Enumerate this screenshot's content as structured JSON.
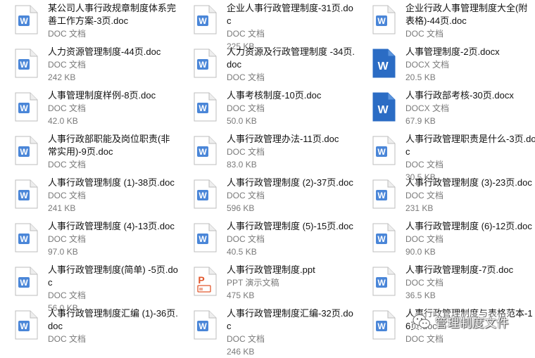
{
  "files": [
    {
      "name": "某公司人事行政规章制度体系完善工作方案-3页.doc",
      "type": "DOC 文档",
      "size": "",
      "icon": "word-doc-icon"
    },
    {
      "name": "企业人事行政管理制度-31页.doc",
      "type": "DOC 文档",
      "size": "225 KB",
      "icon": "word-doc-icon"
    },
    {
      "name": "企业行政人事管理制度大全(附表格)-44页.doc",
      "type": "DOC 文档",
      "size": "",
      "icon": "word-doc-icon"
    },
    {
      "name": "人力资源管理制度-44页.doc",
      "type": "DOC 文档",
      "size": "242 KB",
      "icon": "word-doc-icon"
    },
    {
      "name": "人力资源及行政管理制度 -34页.doc",
      "type": "DOC 文档",
      "size": "",
      "icon": "word-doc-icon"
    },
    {
      "name": "人事管理制度-2页.docx",
      "type": "DOCX 文档",
      "size": "20.5 KB",
      "icon": "word-docx-icon"
    },
    {
      "name": "人事管理制度样例-8页.doc",
      "type": "DOC 文档",
      "size": "42.0 KB",
      "icon": "word-doc-icon"
    },
    {
      "name": "人事考核制度-10页.doc",
      "type": "DOC 文档",
      "size": "50.0 KB",
      "icon": "word-doc-icon"
    },
    {
      "name": "人事行政部考核-30页.docx",
      "type": "DOCX 文档",
      "size": "67.9 KB",
      "icon": "word-docx-icon"
    },
    {
      "name": "人事行政部职能及岗位职责(非常实用)-9页.doc",
      "type": "DOC 文档",
      "size": "",
      "icon": "word-doc-icon"
    },
    {
      "name": "人事行政管理办法-11页.doc",
      "type": "DOC 文档",
      "size": "83.0 KB",
      "icon": "word-doc-icon"
    },
    {
      "name": "人事行政管理职责是什么-3页.doc",
      "type": "DOC 文档",
      "size": "30.5 KB",
      "icon": "word-doc-icon"
    },
    {
      "name": "人事行政管理制度 (1)-38页.doc",
      "type": "DOC 文档",
      "size": "241 KB",
      "icon": "word-doc-icon"
    },
    {
      "name": "人事行政管理制度 (2)-37页.doc",
      "type": "DOC 文档",
      "size": "596 KB",
      "icon": "word-doc-icon"
    },
    {
      "name": "人事行政管理制度 (3)-23页.doc",
      "type": "DOC 文档",
      "size": "231 KB",
      "icon": "word-doc-icon"
    },
    {
      "name": "人事行政管理制度 (4)-13页.doc",
      "type": "DOC 文档",
      "size": "97.0 KB",
      "icon": "word-doc-icon"
    },
    {
      "name": "人事行政管理制度 (5)-15页.doc",
      "type": "DOC 文档",
      "size": "40.5 KB",
      "icon": "word-doc-icon"
    },
    {
      "name": "人事行政管理制度 (6)-12页.doc",
      "type": "DOC 文档",
      "size": "90.0 KB",
      "icon": "word-doc-icon"
    },
    {
      "name": "人事行政管理制度(简单) -5页.doc",
      "type": "DOC 文档",
      "size": "56.0 KB",
      "icon": "word-doc-icon"
    },
    {
      "name": "人事行政管理制度.ppt",
      "type": "PPT 演示文稿",
      "size": "475 KB",
      "icon": "ppt-icon"
    },
    {
      "name": "人事行政管理制度-7页.doc",
      "type": "DOC 文档",
      "size": "36.5 KB",
      "icon": "word-doc-icon"
    },
    {
      "name": "人事行政管理制度汇编 (1)-36页.doc",
      "type": "DOC 文档",
      "size": "",
      "icon": "word-doc-icon"
    },
    {
      "name": "人事行政管理制度汇编-32页.doc",
      "type": "DOC 文档",
      "size": "246 KB",
      "icon": "word-doc-icon"
    },
    {
      "name": "人事行政管理制度与表格范本-16页.doc",
      "type": "DOC 文档",
      "size": "",
      "icon": "word-doc-icon"
    }
  ],
  "watermark": {
    "text": "管理制度文件",
    "icon": "wechat-icon"
  }
}
